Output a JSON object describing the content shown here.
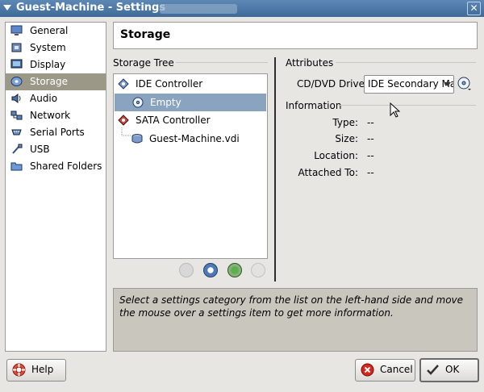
{
  "window": {
    "title": "Guest-Machine - Settings",
    "close_glyph": "✕"
  },
  "sidebar": {
    "items": [
      {
        "label": "General",
        "icon": "monitor-icon"
      },
      {
        "label": "System",
        "icon": "chip-icon"
      },
      {
        "label": "Display",
        "icon": "display-icon"
      },
      {
        "label": "Storage",
        "icon": "disk-icon",
        "selected": true
      },
      {
        "label": "Audio",
        "icon": "speaker-icon"
      },
      {
        "label": "Network",
        "icon": "network-icon"
      },
      {
        "label": "Serial Ports",
        "icon": "serial-port-icon"
      },
      {
        "label": "USB",
        "icon": "usb-icon"
      },
      {
        "label": "Shared Folders",
        "icon": "folder-icon"
      }
    ]
  },
  "header": {
    "title": "Storage"
  },
  "storage_tree": {
    "legend": "Storage Tree",
    "nodes": [
      {
        "label": "IDE Controller",
        "icon": "ide-controller-icon"
      },
      {
        "label": "Empty",
        "icon": "cd-icon",
        "selected": true
      },
      {
        "label": "SATA Controller",
        "icon": "sata-controller-icon"
      },
      {
        "label": "Guest-Machine.vdi",
        "icon": "hard-disk-icon"
      }
    ],
    "tools": [
      "add-controller-icon",
      "remove-controller-icon",
      "add-attachment-icon",
      "remove-attachment-icon"
    ]
  },
  "attributes": {
    "legend": "Attributes",
    "cd_label": "CD/DVD Drive:",
    "cd_value": "IDE Secondary Master"
  },
  "information": {
    "legend": "Information",
    "rows": [
      {
        "key": "Type:",
        "value": "--"
      },
      {
        "key": "Size:",
        "value": "--"
      },
      {
        "key": "Location:",
        "value": "--"
      },
      {
        "key": "Attached To:",
        "value": "--"
      }
    ]
  },
  "description": "Select a settings category from the list on the left-hand side and move the mouse over a settings item to get more information.",
  "buttons": {
    "help": "Help",
    "cancel": "Cancel",
    "ok": "OK"
  },
  "colors": {
    "titlebar": "#4a77a8",
    "selection_sidebar": "#9c9888",
    "selection_tree": "#8aa4bf"
  }
}
